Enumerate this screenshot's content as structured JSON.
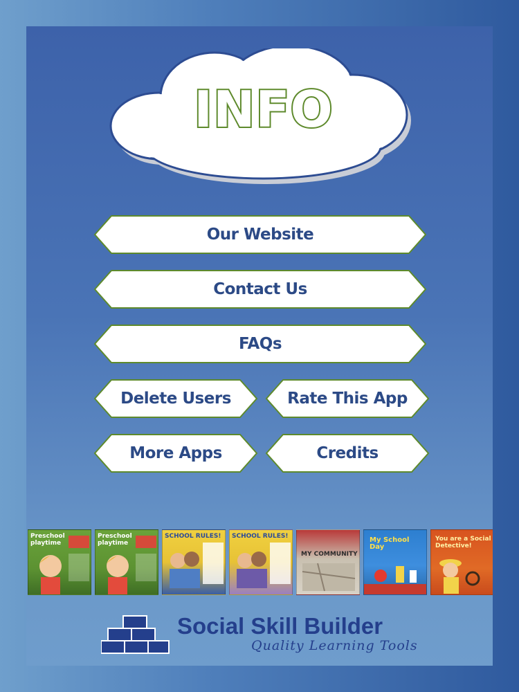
{
  "header": {
    "title": "INFO"
  },
  "buttons": {
    "website": "Our Website",
    "contact": "Contact Us",
    "faqs": "FAQs",
    "delete_users": "Delete Users",
    "rate_app": "Rate This App",
    "more_apps": "More Apps",
    "credits": "Credits"
  },
  "products": [
    {
      "title": "Preschool playtime"
    },
    {
      "title": "Preschool playtime"
    },
    {
      "title": "SCHOOL RULES!"
    },
    {
      "title": "SCHOOL RULES!"
    },
    {
      "title": "MY COMMUNITY"
    },
    {
      "title": "My School Day"
    },
    {
      "title": "You are a Social Detective!"
    }
  ],
  "footer": {
    "brand": "Social Skill Builder",
    "tagline": "Quality Learning Tools"
  },
  "colors": {
    "button_text": "#2c4a86",
    "button_border": "#5e8a2c",
    "title_outline": "#5e8a2c",
    "brand": "#243f8c"
  }
}
